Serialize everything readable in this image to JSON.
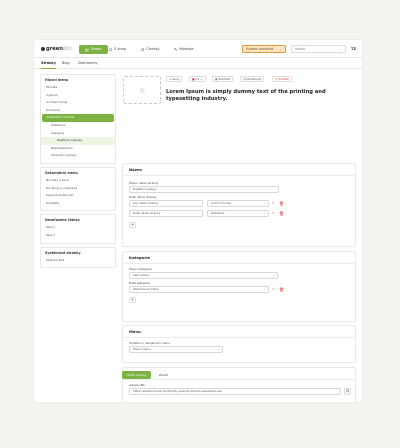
{
  "topbar": {
    "logo_text": "green",
    "logo_suffix": "dot",
    "nav": [
      {
        "label": "Obsah",
        "icon": "content-icon"
      },
      {
        "label": "E-shop",
        "icon": "cart-icon"
      },
      {
        "label": "Členský",
        "icon": "members-icon"
      },
      {
        "label": "Nástroje",
        "icon": "tools-icon"
      }
    ],
    "environment_select": "Výrobní prostředí",
    "search_placeholder": "Hledat",
    "user_initials": "TZ"
  },
  "subtabs": [
    "Stránky",
    "Blog",
    "Dokumenty"
  ],
  "sidebar": {
    "groups": [
      {
        "title": "Hlavní menu",
        "items": [
          {
            "label": "Témata",
            "level": 1
          },
          {
            "label": "Výzkum",
            "level": 1
          },
          {
            "label": "Archivní fondy",
            "level": 1
          },
          {
            "label": "Knihovna",
            "level": 1
          },
          {
            "label": "Publikační činnost",
            "level": 1,
            "state": "active"
          },
          {
            "label": "Publikace",
            "level": 2
          },
          {
            "label": "Časopisy",
            "level": 2
          },
          {
            "label": "Digitální výstupy",
            "level": 3,
            "state": "sub"
          },
          {
            "label": "Nakladatelství",
            "level": 2
          },
          {
            "label": "Vědecké výstupy",
            "level": 2
          }
        ]
      },
      {
        "title": "Sekundární menu",
        "items": [
          {
            "label": "Novinky a akce",
            "level": 1
          },
          {
            "label": "Pro školy a veřejnost",
            "level": 1
          },
          {
            "label": "Spisová služba AV",
            "level": 1
          },
          {
            "label": "Kontakty",
            "level": 1
          }
        ]
      },
      {
        "title": "Nezařazené články",
        "items": [
          {
            "label": "Test 1",
            "level": 1
          },
          {
            "label": "Test 2",
            "level": 1
          }
        ]
      },
      {
        "title": "Systémové stránky",
        "items": [
          {
            "label": "Stránka 404",
            "level": 1
          }
        ]
      }
    ]
  },
  "toolbar": {
    "add_label": "+ Akce",
    "lang_label": "CS",
    "view_label": "Zobrazit",
    "duplicate_label": "Duplikovat",
    "delete_label": "Smazat"
  },
  "page_heading": "Lorem Ipsum is simply dummy text of the printing and typesetting industry.",
  "tabs": [
    "Detail",
    "Obsah",
    "Fotografie",
    "Přílohy",
    "Nastavení",
    "Propojení obsahu",
    "Pokročilejší funkce"
  ],
  "cards": {
    "name": {
      "title": "Název",
      "main_label": "Hlavní název stránky",
      "main_value": "Digitální výstupy",
      "other_label": "Další názvy stránky",
      "rows": [
        {
          "value": "Jiný název stránky",
          "select": "Archivní fondy"
        },
        {
          "value": "Další název stránky",
          "select": "Publikace"
        }
      ]
    },
    "category": {
      "title": "Kategorie",
      "main_label": "Hlavní kategorie",
      "main_value": "Letní zpěvy",
      "other_label": "Další kategorie",
      "other_value": "Obsluhovací plány"
    },
    "menu": {
      "title": "Menu",
      "label": "Umístění v navigačním menu",
      "value": "Hlavní menu"
    },
    "other": {
      "title": "Ostatní",
      "label": "Adresa URL",
      "value": "https://www.muzcas.cz/cz/fondy-a-sbirky-archivu-akademie-ved"
    }
  },
  "footer": {
    "save_label": "Uložit úpravy",
    "close_label": "Zrušit"
  },
  "colors": {
    "accent": "#7bb243",
    "environment": "#e09a3a",
    "danger": "#dd3333",
    "background": "#f3f3ef"
  }
}
